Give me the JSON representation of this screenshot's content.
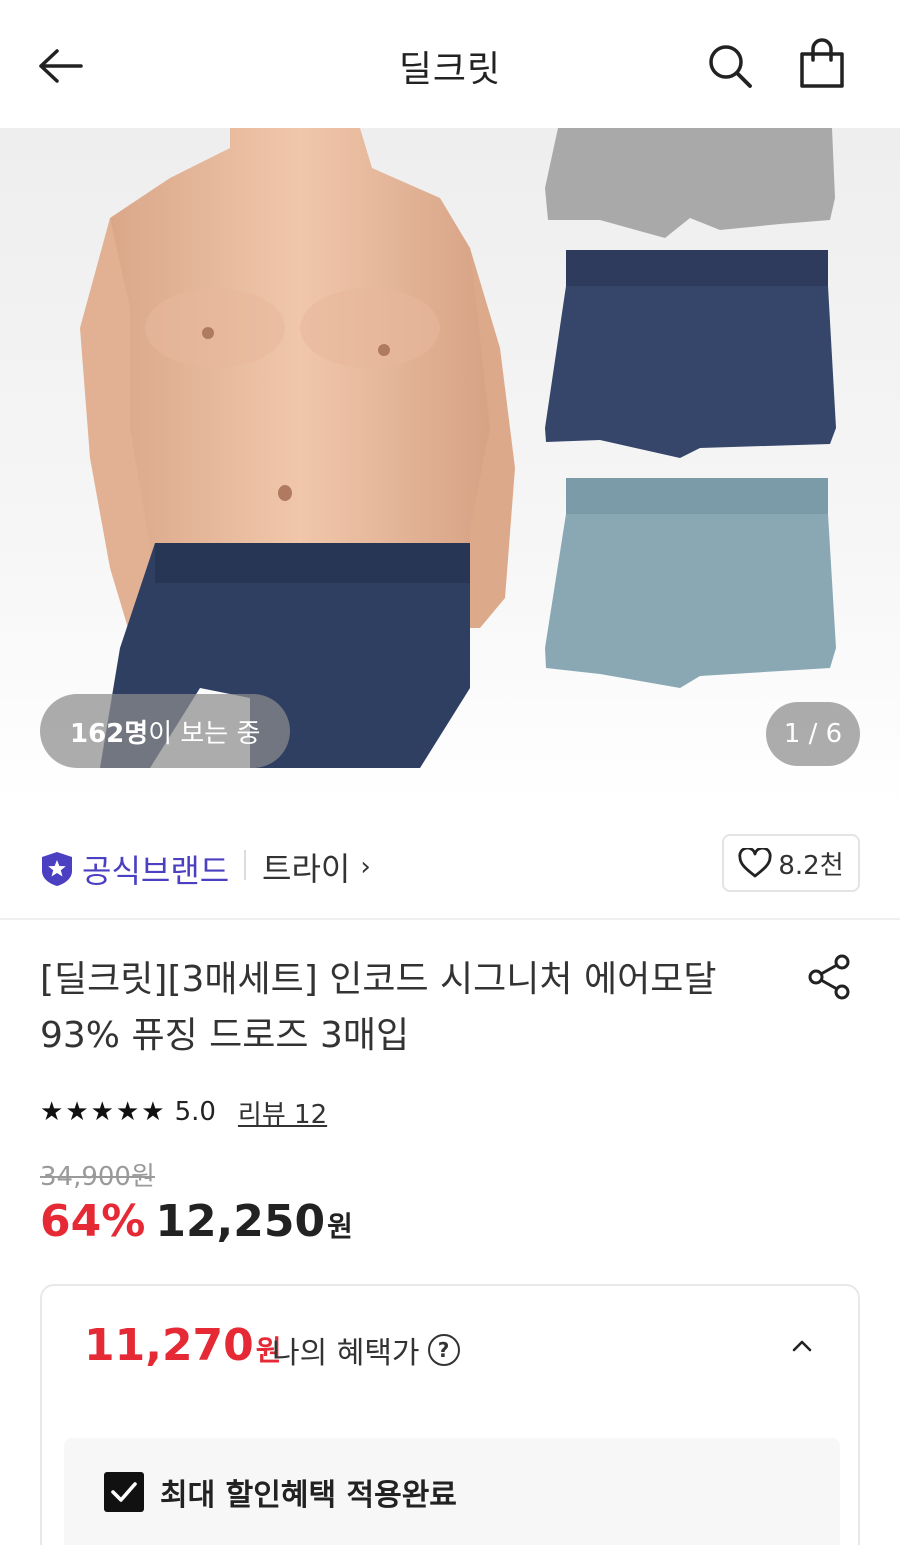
{
  "header": {
    "title": "딜크릿",
    "back_icon": "arrow-left-icon",
    "search_icon": "search-icon",
    "bag_icon": "shopping-bag-icon"
  },
  "hero": {
    "viewers_count": "162명",
    "viewers_suffix": "이 보는 중",
    "image_counter": "1 / 6"
  },
  "brand": {
    "official_label": "공식브랜드",
    "name": "트라이",
    "chevron": "›",
    "likes": "8.2천",
    "accent_color": "#4b3fc2"
  },
  "product": {
    "title": "[딜크릿][3매세트] 인코드 시그니처 에어모달93% 퓨징 드로즈 3매입",
    "rating": "5.0",
    "review_link": "리뷰 12",
    "stars": [
      "★",
      "★",
      "★",
      "★",
      "★"
    ],
    "original_price": "34,900원",
    "discount_rate": "64%",
    "price": "12,250",
    "price_unit": "원",
    "discount_color": "#e52a35"
  },
  "benefit": {
    "price": "11,270",
    "price_unit": "원",
    "label": "나의 혜택가",
    "help": "?",
    "check_label": "최대 할인혜택 적용완료"
  }
}
